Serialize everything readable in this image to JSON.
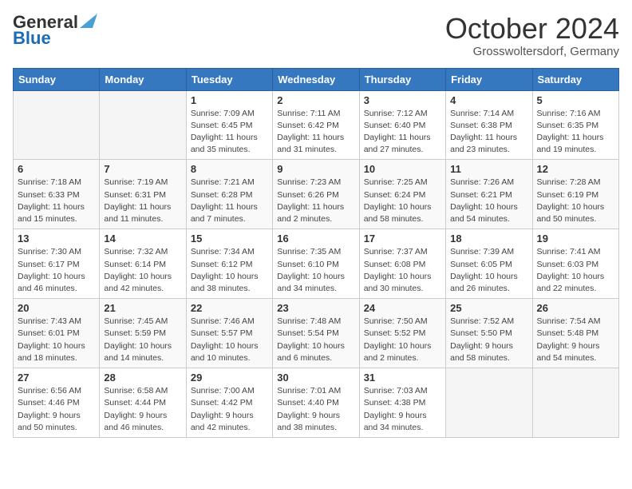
{
  "header": {
    "logo_line1": "General",
    "logo_line2": "Blue",
    "month_title": "October 2024",
    "location": "Grosswoltersdorf, Germany"
  },
  "days_of_week": [
    "Sunday",
    "Monday",
    "Tuesday",
    "Wednesday",
    "Thursday",
    "Friday",
    "Saturday"
  ],
  "weeks": [
    [
      {
        "day": "",
        "empty": true
      },
      {
        "day": "",
        "empty": true
      },
      {
        "day": "1",
        "sunrise": "7:09 AM",
        "sunset": "6:45 PM",
        "daylight": "11 hours and 35 minutes."
      },
      {
        "day": "2",
        "sunrise": "7:11 AM",
        "sunset": "6:42 PM",
        "daylight": "11 hours and 31 minutes."
      },
      {
        "day": "3",
        "sunrise": "7:12 AM",
        "sunset": "6:40 PM",
        "daylight": "11 hours and 27 minutes."
      },
      {
        "day": "4",
        "sunrise": "7:14 AM",
        "sunset": "6:38 PM",
        "daylight": "11 hours and 23 minutes."
      },
      {
        "day": "5",
        "sunrise": "7:16 AM",
        "sunset": "6:35 PM",
        "daylight": "11 hours and 19 minutes."
      }
    ],
    [
      {
        "day": "6",
        "sunrise": "7:18 AM",
        "sunset": "6:33 PM",
        "daylight": "11 hours and 15 minutes."
      },
      {
        "day": "7",
        "sunrise": "7:19 AM",
        "sunset": "6:31 PM",
        "daylight": "11 hours and 11 minutes."
      },
      {
        "day": "8",
        "sunrise": "7:21 AM",
        "sunset": "6:28 PM",
        "daylight": "11 hours and 7 minutes."
      },
      {
        "day": "9",
        "sunrise": "7:23 AM",
        "sunset": "6:26 PM",
        "daylight": "11 hours and 2 minutes."
      },
      {
        "day": "10",
        "sunrise": "7:25 AM",
        "sunset": "6:24 PM",
        "daylight": "10 hours and 58 minutes."
      },
      {
        "day": "11",
        "sunrise": "7:26 AM",
        "sunset": "6:21 PM",
        "daylight": "10 hours and 54 minutes."
      },
      {
        "day": "12",
        "sunrise": "7:28 AM",
        "sunset": "6:19 PM",
        "daylight": "10 hours and 50 minutes."
      }
    ],
    [
      {
        "day": "13",
        "sunrise": "7:30 AM",
        "sunset": "6:17 PM",
        "daylight": "10 hours and 46 minutes."
      },
      {
        "day": "14",
        "sunrise": "7:32 AM",
        "sunset": "6:14 PM",
        "daylight": "10 hours and 42 minutes."
      },
      {
        "day": "15",
        "sunrise": "7:34 AM",
        "sunset": "6:12 PM",
        "daylight": "10 hours and 38 minutes."
      },
      {
        "day": "16",
        "sunrise": "7:35 AM",
        "sunset": "6:10 PM",
        "daylight": "10 hours and 34 minutes."
      },
      {
        "day": "17",
        "sunrise": "7:37 AM",
        "sunset": "6:08 PM",
        "daylight": "10 hours and 30 minutes."
      },
      {
        "day": "18",
        "sunrise": "7:39 AM",
        "sunset": "6:05 PM",
        "daylight": "10 hours and 26 minutes."
      },
      {
        "day": "19",
        "sunrise": "7:41 AM",
        "sunset": "6:03 PM",
        "daylight": "10 hours and 22 minutes."
      }
    ],
    [
      {
        "day": "20",
        "sunrise": "7:43 AM",
        "sunset": "6:01 PM",
        "daylight": "10 hours and 18 minutes."
      },
      {
        "day": "21",
        "sunrise": "7:45 AM",
        "sunset": "5:59 PM",
        "daylight": "10 hours and 14 minutes."
      },
      {
        "day": "22",
        "sunrise": "7:46 AM",
        "sunset": "5:57 PM",
        "daylight": "10 hours and 10 minutes."
      },
      {
        "day": "23",
        "sunrise": "7:48 AM",
        "sunset": "5:54 PM",
        "daylight": "10 hours and 6 minutes."
      },
      {
        "day": "24",
        "sunrise": "7:50 AM",
        "sunset": "5:52 PM",
        "daylight": "10 hours and 2 minutes."
      },
      {
        "day": "25",
        "sunrise": "7:52 AM",
        "sunset": "5:50 PM",
        "daylight": "9 hours and 58 minutes."
      },
      {
        "day": "26",
        "sunrise": "7:54 AM",
        "sunset": "5:48 PM",
        "daylight": "9 hours and 54 minutes."
      }
    ],
    [
      {
        "day": "27",
        "sunrise": "6:56 AM",
        "sunset": "4:46 PM",
        "daylight": "9 hours and 50 minutes."
      },
      {
        "day": "28",
        "sunrise": "6:58 AM",
        "sunset": "4:44 PM",
        "daylight": "9 hours and 46 minutes."
      },
      {
        "day": "29",
        "sunrise": "7:00 AM",
        "sunset": "4:42 PM",
        "daylight": "9 hours and 42 minutes."
      },
      {
        "day": "30",
        "sunrise": "7:01 AM",
        "sunset": "4:40 PM",
        "daylight": "9 hours and 38 minutes."
      },
      {
        "day": "31",
        "sunrise": "7:03 AM",
        "sunset": "4:38 PM",
        "daylight": "9 hours and 34 minutes."
      },
      {
        "day": "",
        "empty": true
      },
      {
        "day": "",
        "empty": true
      }
    ]
  ]
}
